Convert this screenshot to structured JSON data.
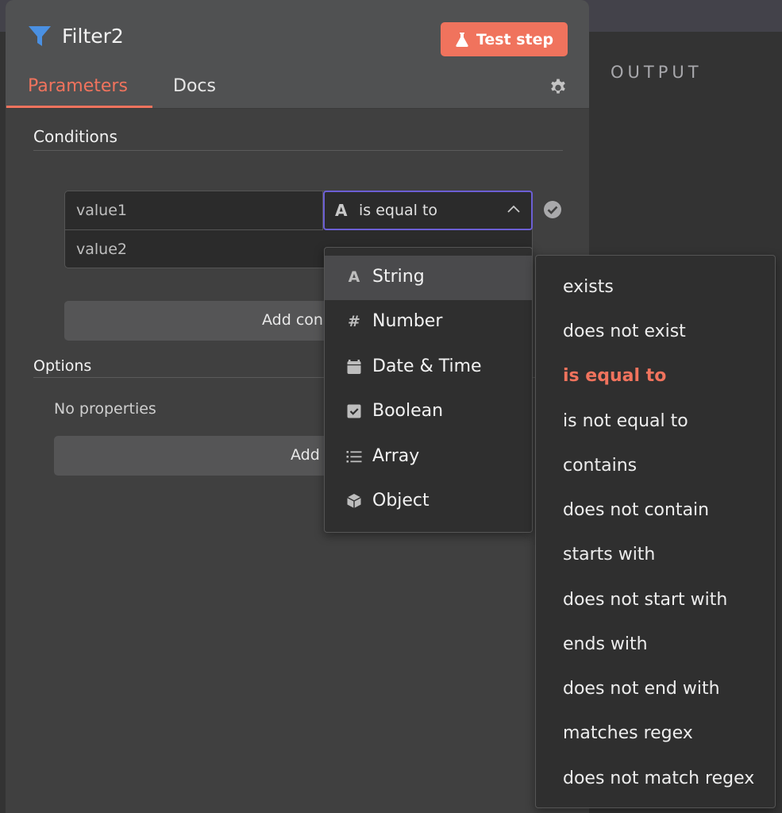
{
  "node": {
    "title": "Filter2",
    "test_button": "Test step"
  },
  "tabs": [
    {
      "label": "Parameters",
      "active": true
    },
    {
      "label": "Docs",
      "active": false
    }
  ],
  "output_label": "OUTPUT",
  "conditions": {
    "title": "Conditions",
    "value1_placeholder": "value1",
    "value2_placeholder": "value2",
    "operator_selected": "is equal to",
    "operator_type_glyph": "A",
    "add_condition_label": "Add con"
  },
  "options": {
    "title": "Options",
    "empty_text": "No properties",
    "add_option_label": "Add"
  },
  "type_menu": {
    "items": [
      {
        "label": "String",
        "icon": "string-icon",
        "glyph": "A",
        "active": true
      },
      {
        "label": "Number",
        "icon": "number-icon",
        "glyph": "#",
        "active": false
      },
      {
        "label": "Date & Time",
        "icon": "calendar-icon",
        "glyph": "",
        "active": false
      },
      {
        "label": "Boolean",
        "icon": "checkbox-icon",
        "glyph": "",
        "active": false
      },
      {
        "label": "Array",
        "icon": "list-icon",
        "glyph": "",
        "active": false
      },
      {
        "label": "Object",
        "icon": "cube-icon",
        "glyph": "",
        "active": false
      }
    ]
  },
  "operator_menu": {
    "items": [
      {
        "label": "exists",
        "selected": false
      },
      {
        "label": "does not exist",
        "selected": false
      },
      {
        "label": "is equal to",
        "selected": true
      },
      {
        "label": "is not equal to",
        "selected": false
      },
      {
        "label": "contains",
        "selected": false
      },
      {
        "label": "does not contain",
        "selected": false
      },
      {
        "label": "starts with",
        "selected": false
      },
      {
        "label": "does not start with",
        "selected": false
      },
      {
        "label": "ends with",
        "selected": false
      },
      {
        "label": "does not end with",
        "selected": false
      },
      {
        "label": "matches regex",
        "selected": false
      },
      {
        "label": "does not match regex",
        "selected": false
      }
    ]
  },
  "colors": {
    "accent": "#f0735d",
    "filter_icon": "#4a90e2",
    "focus_border": "#6c5fd4"
  }
}
